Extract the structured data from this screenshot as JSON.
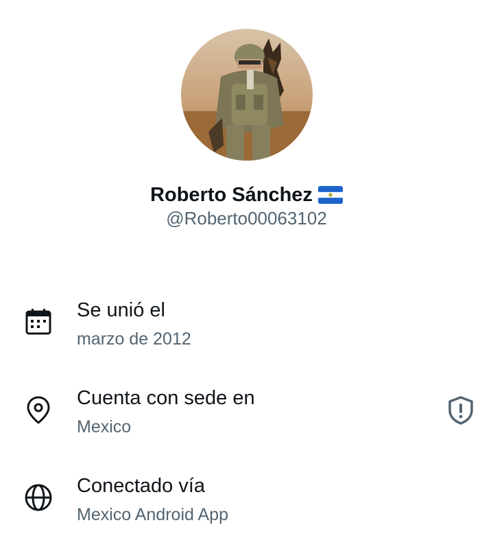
{
  "profile": {
    "name": "Roberto Sánchez",
    "flag": "Nicaragua flag",
    "handle": "@Roberto00063102",
    "avatar": "soldier-with-dog-photo"
  },
  "info": [
    {
      "icon": "calendar-icon",
      "title": "Se unió el",
      "value": "marzo de 2012"
    },
    {
      "icon": "location-pin-icon",
      "title": "Cuenta con sede en",
      "value": "Mexico",
      "badge_icon": "shield-alert-icon"
    },
    {
      "icon": "globe-icon",
      "title": "Conectado vía",
      "value": "Mexico Android App"
    }
  ],
  "colors": {
    "text_primary": "#0f1419",
    "text_secondary": "#536471",
    "flag_blue": "#1d63c9"
  }
}
